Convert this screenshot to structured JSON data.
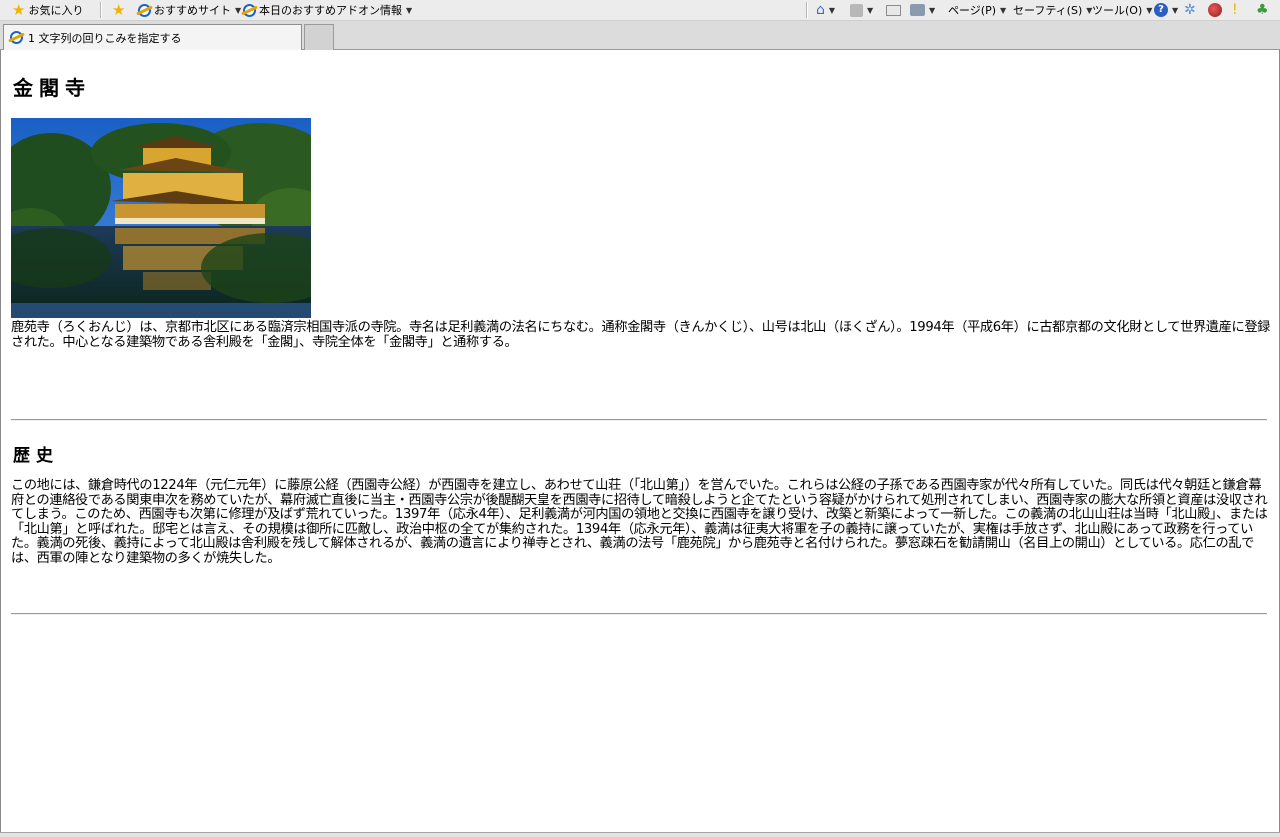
{
  "toolbar": {
    "favorites_label": "お気に入り",
    "recommended_sites_label": "おすすめサイト",
    "addons_label": "本日のおすすめアドオン情報",
    "page_label": "ページ(P)",
    "safety_label": "セーフティ(S)",
    "tools_label": "ツール(O)",
    "help_glyph": "?"
  },
  "tab": {
    "title": "1 文字列の回りこみを指定する"
  },
  "article": {
    "title": "金閣寺",
    "image_alt": "金閣寺",
    "intro": "鹿苑寺（ろくおんじ）は、京都市北区にある臨済宗相国寺派の寺院。寺名は足利義満の法名にちなむ。通称金閣寺（きんかくじ）、山号は北山（ほくざん）。1994年（平成6年）に古都京都の文化財として世界遺産に登録された。中心となる建築物である舎利殿を「金閣」、寺院全体を「金閣寺」と通称する。",
    "history_heading": "歴史",
    "history": "この地には、鎌倉時代の1224年（元仁元年）に藤原公経（西園寺公経）が西園寺を建立し、あわせて山荘（「北山第」）を営んでいた。これらは公経の子孫である西園寺家が代々所有していた。同氏は代々朝廷と鎌倉幕府との連絡役である関東申次を務めていたが、幕府滅亡直後に当主・西園寺公宗が後醍醐天皇を西園寺に招待して暗殺しようと企てたという容疑がかけられて処刑されてしまい、西園寺家の膨大な所領と資産は没収されてしまう。このため、西園寺も次第に修理が及ばず荒れていった。1397年（応永4年）、足利義満が河内国の領地と交換に西園寺を譲り受け、改築と新築によって一新した。この義満の北山山荘は当時「北山殿」、または「北山第」と呼ばれた。邸宅とは言え、その規模は御所に匹敵し、政治中枢の全てが集約された。1394年（応永元年）、義満は征夷大将軍を子の義持に譲っていたが、実権は手放さず、北山殿にあって政務を行っていた。義満の死後、義持によって北山殿は舎利殿を残して解体されるが、義満の遺言により禅寺とされ、義満の法号「鹿苑院」から鹿苑寺と名付けられた。夢窓疎石を勧請開山（名目上の開山）としている。応仁の乱では、西軍の陣となり建築物の多くが焼失した。"
  }
}
